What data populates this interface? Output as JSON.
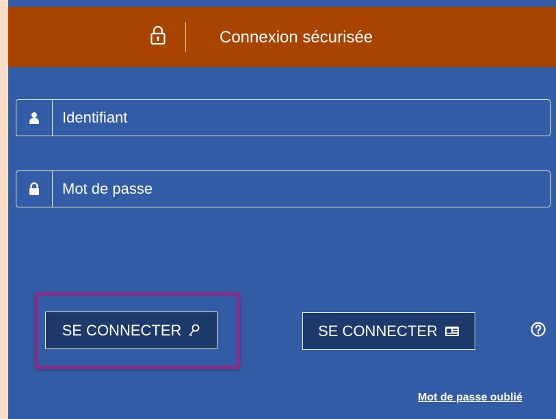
{
  "header": {
    "title": "Connexion sécurisée",
    "icon": "lock-icon"
  },
  "login_form": {
    "username": {
      "placeholder": "Identifiant",
      "value": "",
      "icon": "user-icon"
    },
    "password": {
      "placeholder": "Mot de passe",
      "value": "",
      "icon": "lock-icon"
    }
  },
  "buttons": {
    "password_login": {
      "label": "SE CONNECTER",
      "icon": "key-icon"
    },
    "card_login": {
      "label": "SE CONNECTER",
      "icon": "id-card-icon"
    },
    "help": {
      "icon": "help-icon"
    }
  },
  "links": {
    "forgot_password": "Mot de passe oublié"
  },
  "colors": {
    "panel_background": "#335ca7",
    "header_background": "#a84300",
    "button_background": "#1d3a6c",
    "highlight_border": "#8a2b86",
    "page_background": "#f9dec6"
  }
}
